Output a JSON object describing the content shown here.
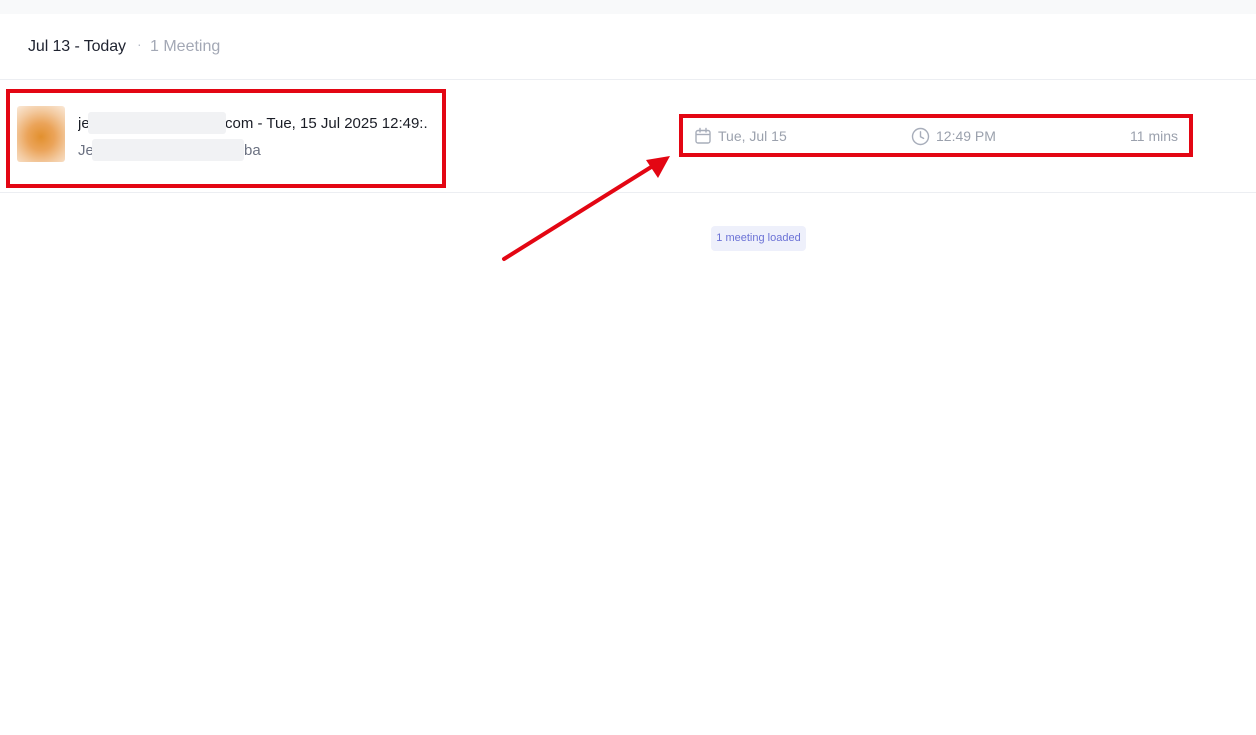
{
  "group": {
    "title": "Jul 13 - Today",
    "separator": "·",
    "count": "1 Meeting"
  },
  "meeting": {
    "thumbnail_color": "#e2902e",
    "title_start": "je",
    "title_end": "com - Tue, 15 Jul 2025 12:49:...",
    "subtitle_start": "Je",
    "subtitle_end": "ba",
    "date_icon": "calendar-icon",
    "date": "Tue, Jul 15",
    "time_icon": "clock-icon",
    "time": "12:49 PM",
    "duration": "11 mins"
  },
  "status": {
    "loaded": "1 meeting loaded"
  },
  "annotations": {
    "highlight_color": "#e30613"
  }
}
